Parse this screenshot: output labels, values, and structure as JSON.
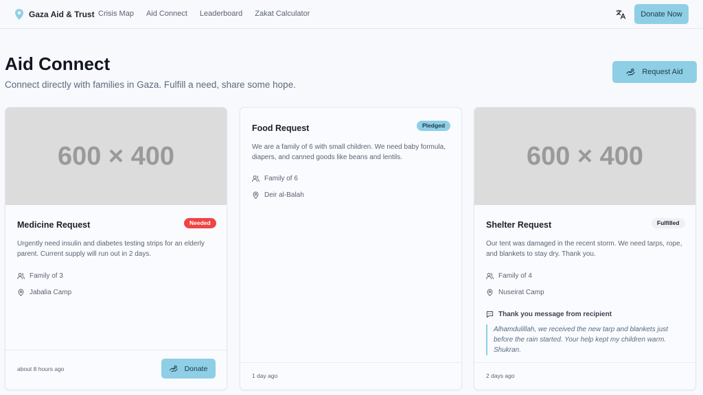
{
  "header": {
    "brand": "Gaza Aid & Trust",
    "nav": [
      "Crisis Map",
      "Aid Connect",
      "Leaderboard",
      "Zakat Calculator"
    ],
    "donate_label": "Donate Now"
  },
  "page": {
    "title": "Aid Connect",
    "subtitle": "Connect directly with families in Gaza. Fulfill a need, share some hope.",
    "request_label": "Request Aid"
  },
  "cards": [
    {
      "image_text": "600 × 400",
      "title": "Medicine Request",
      "status": "Needed",
      "description": "Urgently need insulin and diabetes testing strips for an elderly parent. Current supply will run out in 2 days.",
      "family": "Family of 3",
      "location": "Jabalia Camp",
      "time": "about 8 hours ago",
      "donate_label": "Donate"
    },
    {
      "title": "Food Request",
      "status": "Pledged",
      "description": "We are a family of 6 with small children. We need baby formula, diapers, and canned goods like beans and lentils.",
      "family": "Family of 6",
      "location": "Deir al-Balah",
      "time": "1 day ago"
    },
    {
      "image_text": "600 × 400",
      "title": "Shelter Request",
      "status": "Fulfilled",
      "description": "Our tent was damaged in the recent storm. We need tarps, rope, and blankets to stay dry. Thank you.",
      "family": "Family of 4",
      "location": "Nuseirat Camp",
      "thanks_title": "Thank you message from recipient",
      "thanks_message": "Alhamdulillah, we received the new tarp and blankets just before the rain started. Your help kept my children warm. Shukran.",
      "time": "2 days ago"
    }
  ],
  "colors": {
    "accent": "#8ecfe6",
    "needed": "#ef4444",
    "background": "#f8f9fc"
  },
  "icons": {
    "brand": "map-pin-icon",
    "language": "translate-icon",
    "request": "hand-coins-icon",
    "family": "users-icon",
    "location": "map-pin-icon",
    "thanks": "message-square-icon"
  }
}
